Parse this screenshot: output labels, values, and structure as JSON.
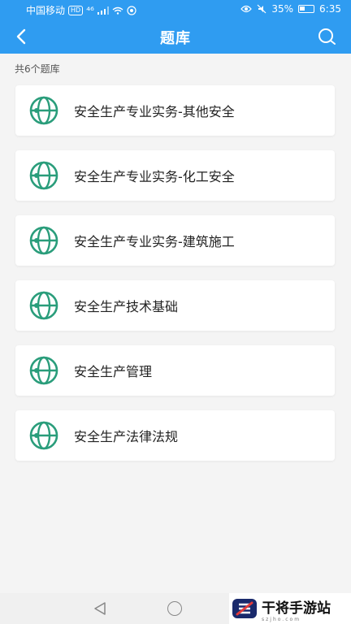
{
  "status_bar": {
    "carrier": "中国移动",
    "hd": "HD",
    "signal_text": "⁴⁶",
    "battery_percent": "35%",
    "time": "6:35"
  },
  "navbar": {
    "title": "题库"
  },
  "bank_count_label": "共6个题库",
  "banks": [
    {
      "label": "安全生产专业实务-其他安全",
      "icon": "globe-icon"
    },
    {
      "label": "安全生产专业实务-化工安全",
      "icon": "globe-icon"
    },
    {
      "label": "安全生产专业实务-建筑施工",
      "icon": "globe-icon"
    },
    {
      "label": "安全生产技术基础",
      "icon": "globe-icon"
    },
    {
      "label": "安全生产管理",
      "icon": "globe-icon"
    },
    {
      "label": "安全生产法律法规",
      "icon": "globe-icon"
    }
  ],
  "watermark": {
    "name": "干将手游站",
    "sub": "szjho.com"
  },
  "colors": {
    "primary": "#2f9cf1",
    "icon_green": "#2a9d7b"
  }
}
